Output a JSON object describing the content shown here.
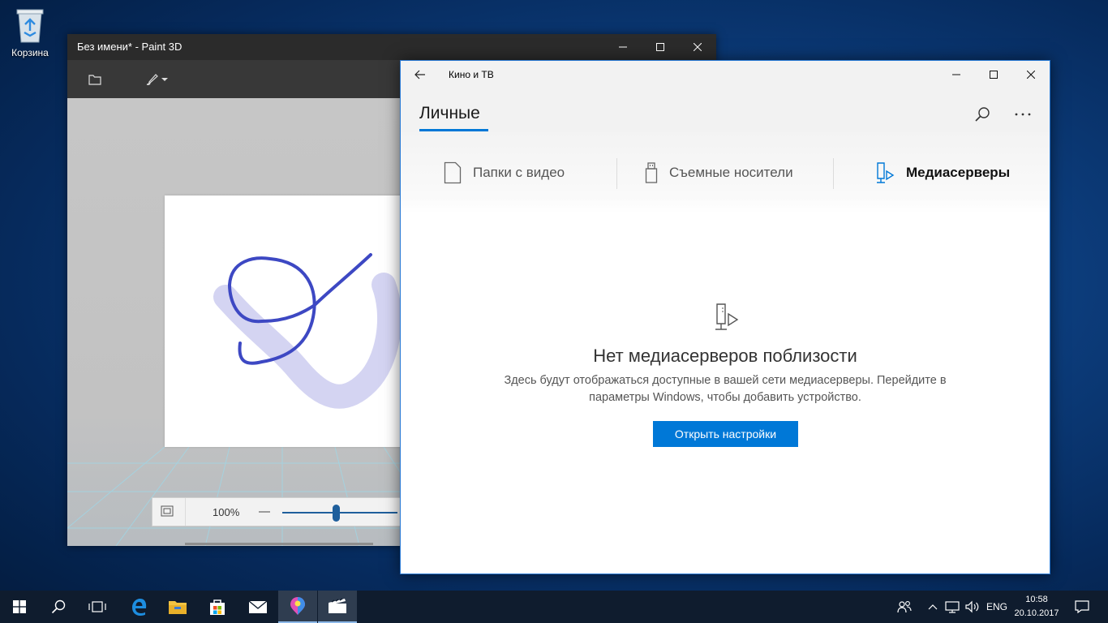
{
  "desktop": {
    "recycle_bin_label": "Корзина"
  },
  "paint3d": {
    "title": "Без имени* - Paint 3D",
    "zoom_level": "100%",
    "zoom_slider_value": 0.47,
    "icons": [
      "folder-icon",
      "brush-icon",
      "chevron-down-icon",
      "fit-screen-icon"
    ]
  },
  "films": {
    "title": "Кино и ТВ",
    "section_title": "Личные",
    "categories": [
      {
        "label": "Папки с видео",
        "icon": "video-folder-icon",
        "active": false
      },
      {
        "label": "Съемные носители",
        "icon": "usb-drive-icon",
        "active": false
      },
      {
        "label": "Медиасерверы",
        "icon": "media-server-icon",
        "active": true
      }
    ],
    "empty_title": "Нет медиасерверов поблизости",
    "empty_description": "Здесь будут отображаться доступные в вашей сети медиасерверы. Перейдите в параметры Windows, чтобы добавить устройство.",
    "open_settings_label": "Открыть настройки",
    "accent_color": "#0078d7"
  },
  "taskbar": {
    "language": "ENG",
    "time": "10:58",
    "date": "20.10.2017",
    "apps": [
      "start-icon",
      "search-icon",
      "task-view-icon",
      "edge-icon",
      "file-explorer-icon",
      "store-icon",
      "mail-icon",
      "paint3d-icon",
      "films-tv-icon"
    ]
  }
}
